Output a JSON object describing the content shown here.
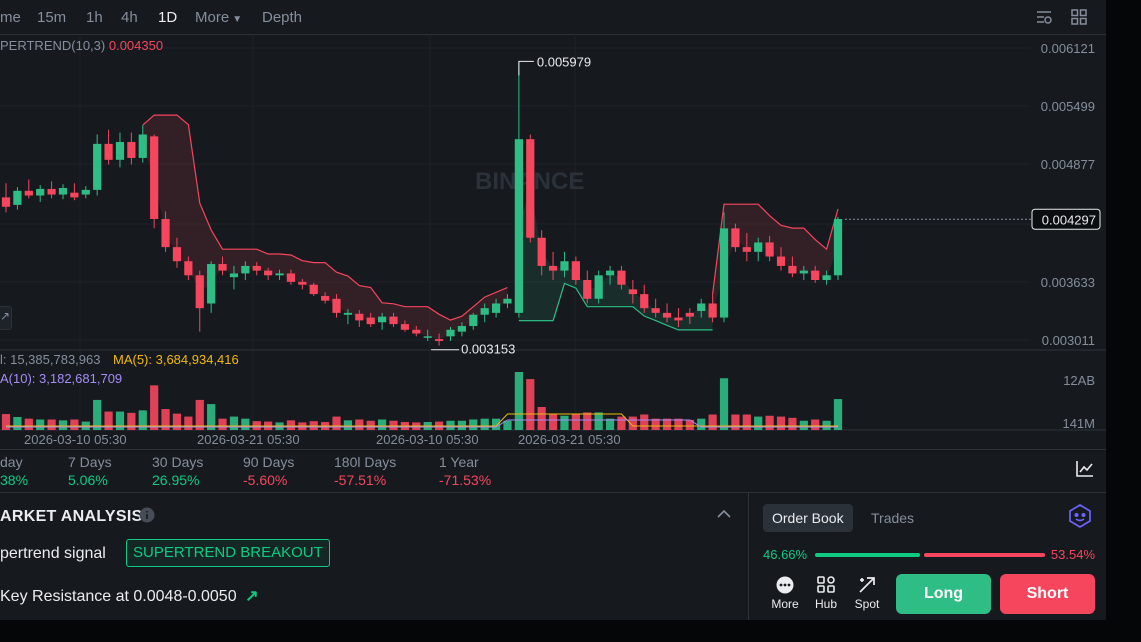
{
  "toolbar": {
    "timeframes": [
      "me",
      "15m",
      "1h",
      "4h",
      "1D"
    ],
    "active": "1D",
    "more": "More",
    "depth": "Depth",
    "icons": [
      "chart-settings-icon",
      "layout-grid-icon"
    ]
  },
  "chart": {
    "indicator_name": "PERTREND(10,3)",
    "indicator_value": "0.004350",
    "watermark": "BINANCE",
    "price_axis": [
      "0.006121",
      "0.005499",
      "0.004877",
      "0.004297",
      "0.003633",
      "0.003011"
    ],
    "current_price": "0.004297",
    "high_label": "0.005979",
    "low_label": "0.003153",
    "vol_line1_left": "l: 15,385,783,963",
    "vol_ma5": "MA(5): 3,684,934,416",
    "vol_ma10": "A(10): 3,182,681,709",
    "vol_axis": [
      "12AB",
      "141M"
    ],
    "date_labels": [
      "2026-03-10 05:30",
      "2026-03-21 05:30",
      "2026-03-10 05:30",
      "2026-03-21 05:30"
    ],
    "colors": {
      "up": "#2ebd85",
      "down": "#f6465d",
      "bg": "#161a1e"
    }
  },
  "chart_data": {
    "type": "candlestick",
    "title": "",
    "y_range": [
      0.003011,
      0.006121
    ],
    "candles": [
      [
        0.00453,
        0.00468,
        0.00437,
        0.00443
      ],
      [
        0.00445,
        0.00464,
        0.0044,
        0.0046
      ],
      [
        0.0046,
        0.00472,
        0.00452,
        0.00455
      ],
      [
        0.00455,
        0.00466,
        0.00448,
        0.00462
      ],
      [
        0.00462,
        0.0047,
        0.00452,
        0.00456
      ],
      [
        0.00456,
        0.00467,
        0.00451,
        0.00463
      ],
      [
        0.00458,
        0.00468,
        0.0045,
        0.00453
      ],
      [
        0.00456,
        0.00465,
        0.00452,
        0.00461
      ],
      [
        0.00461,
        0.0052,
        0.00455,
        0.0051
      ],
      [
        0.0051,
        0.00525,
        0.00488,
        0.00493
      ],
      [
        0.00493,
        0.00522,
        0.00485,
        0.00512
      ],
      [
        0.00512,
        0.00522,
        0.00488,
        0.00495
      ],
      [
        0.00495,
        0.0053,
        0.0049,
        0.0052
      ],
      [
        0.00518,
        0.0052,
        0.0042,
        0.0043
      ],
      [
        0.0043,
        0.00438,
        0.00395,
        0.004
      ],
      [
        0.004,
        0.0041,
        0.00378,
        0.00385
      ],
      [
        0.00385,
        0.0039,
        0.00365,
        0.0037
      ],
      [
        0.0037,
        0.00375,
        0.0031,
        0.00335
      ],
      [
        0.0034,
        0.00385,
        0.0033,
        0.00382
      ],
      [
        0.00382,
        0.0039,
        0.0037,
        0.00375
      ],
      [
        0.00368,
        0.0038,
        0.00355,
        0.00372
      ],
      [
        0.00372,
        0.00385,
        0.00365,
        0.0038
      ],
      [
        0.0038,
        0.00384,
        0.0037,
        0.00375
      ],
      [
        0.00375,
        0.00378,
        0.00365,
        0.0037
      ],
      [
        0.0037,
        0.00376,
        0.00365,
        0.00372
      ],
      [
        0.00372,
        0.00376,
        0.0036,
        0.00363
      ],
      [
        0.00363,
        0.00366,
        0.00355,
        0.0036
      ],
      [
        0.0036,
        0.00362,
        0.00348,
        0.0035
      ],
      [
        0.00348,
        0.00352,
        0.0034,
        0.00343
      ],
      [
        0.00345,
        0.0035,
        0.00325,
        0.0033
      ],
      [
        0.00328,
        0.00334,
        0.00318,
        0.0033
      ],
      [
        0.00329,
        0.00333,
        0.00315,
        0.00322
      ],
      [
        0.00325,
        0.0033,
        0.00315,
        0.00318
      ],
      [
        0.0032,
        0.0033,
        0.00312,
        0.00326
      ],
      [
        0.00326,
        0.0033,
        0.00315,
        0.00318
      ],
      [
        0.00318,
        0.00322,
        0.0031,
        0.00312
      ],
      [
        0.00312,
        0.00316,
        0.00305,
        0.00308
      ],
      [
        0.00305,
        0.00312,
        0.003,
        0.00305
      ],
      [
        0.00302,
        0.00308,
        0.00295,
        0.003
      ],
      [
        0.00305,
        0.00315,
        0.003,
        0.00312
      ],
      [
        0.0031,
        0.0032,
        0.00305,
        0.00316
      ],
      [
        0.00316,
        0.0033,
        0.00312,
        0.00328
      ],
      [
        0.00328,
        0.0034,
        0.0032,
        0.00335
      ],
      [
        0.0033,
        0.00345,
        0.00325,
        0.0034
      ],
      [
        0.0034,
        0.0035,
        0.00335,
        0.00345
      ],
      [
        0.0033,
        0.00598,
        0.00325,
        0.00515
      ],
      [
        0.00515,
        0.0052,
        0.00405,
        0.0041
      ],
      [
        0.0041,
        0.00418,
        0.0037,
        0.0038
      ],
      [
        0.0038,
        0.00395,
        0.00365,
        0.00375
      ],
      [
        0.00375,
        0.00395,
        0.00368,
        0.00385
      ],
      [
        0.00385,
        0.0039,
        0.0036,
        0.00365
      ],
      [
        0.00365,
        0.00375,
        0.0034,
        0.00345
      ],
      [
        0.00345,
        0.00375,
        0.0034,
        0.0037
      ],
      [
        0.0037,
        0.0038,
        0.0036,
        0.00375
      ],
      [
        0.00375,
        0.0038,
        0.00355,
        0.0036
      ],
      [
        0.00355,
        0.00365,
        0.0034,
        0.0035
      ],
      [
        0.0035,
        0.0036,
        0.0033,
        0.00335
      ],
      [
        0.00335,
        0.00345,
        0.00325,
        0.0033
      ],
      [
        0.0033,
        0.0034,
        0.0032,
        0.00325
      ],
      [
        0.00325,
        0.00335,
        0.00315,
        0.00322
      ],
      [
        0.0033,
        0.00335,
        0.00318,
        0.00326
      ],
      [
        0.00332,
        0.00345,
        0.00325,
        0.0034
      ],
      [
        0.0034,
        0.0035,
        0.0032,
        0.00325
      ],
      [
        0.00325,
        0.00437,
        0.0032,
        0.0042
      ],
      [
        0.0042,
        0.00425,
        0.00395,
        0.004
      ],
      [
        0.004,
        0.00415,
        0.00385,
        0.00395
      ],
      [
        0.00395,
        0.0041,
        0.00385,
        0.00405
      ],
      [
        0.00405,
        0.00412,
        0.00385,
        0.0039
      ],
      [
        0.0039,
        0.004,
        0.00375,
        0.0038
      ],
      [
        0.0038,
        0.0039,
        0.00368,
        0.00372
      ],
      [
        0.00372,
        0.0038,
        0.00365,
        0.00375
      ],
      [
        0.00375,
        0.0038,
        0.00362,
        0.00365
      ],
      [
        0.00365,
        0.00375,
        0.0036,
        0.0037
      ],
      [
        0.0037,
        0.00432,
        0.00365,
        0.0043
      ]
    ],
    "volume_max_label": "12AB"
  },
  "performance": [
    {
      "label": "day",
      "value": "38%",
      "tone": "pos"
    },
    {
      "label": "7 Days",
      "value": "5.06%",
      "tone": "pos"
    },
    {
      "label": "30 Days",
      "value": "26.95%",
      "tone": "pos"
    },
    {
      "label": "90 Days",
      "value": "-5.60%",
      "tone": "neg"
    },
    {
      "label": "180l Days",
      "value": "-57.51%",
      "tone": "neg"
    },
    {
      "label": "1 Year",
      "value": "-71.53%",
      "tone": "neg"
    }
  ],
  "analysis": {
    "title": "ARKET ANALYSIS",
    "signal_label": "pertrend signal",
    "signal_badge": "SUPERTREND BREAKOUT",
    "resistance": "Key Resistance at 0.0048-0.0050"
  },
  "orderbook": {
    "tabs": [
      "Order Book",
      "Trades"
    ],
    "buy_ratio": "46.66%",
    "sell_ratio": "53.54%",
    "buy_fraction": 0.4666,
    "actions": [
      "More",
      "Hub",
      "Spot"
    ],
    "long_label": "Long",
    "short_label": "Short"
  }
}
